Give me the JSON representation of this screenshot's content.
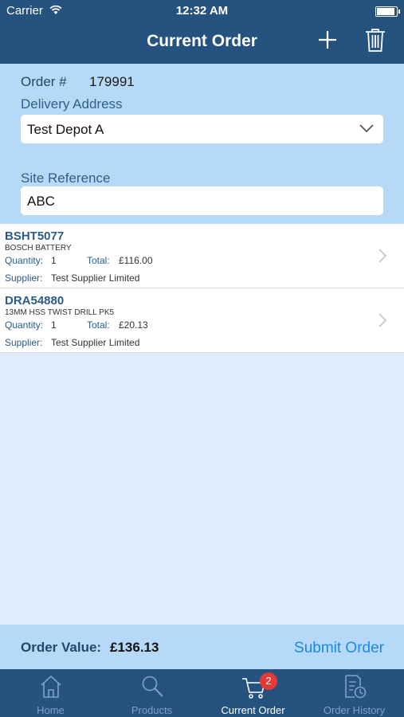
{
  "status_bar": {
    "carrier": "Carrier",
    "time": "12:32 AM"
  },
  "nav": {
    "title": "Current Order",
    "add_icon": "plus-icon",
    "delete_icon": "trash-icon"
  },
  "order": {
    "number_label": "Order #",
    "number": "179991",
    "address_label": "Delivery Address",
    "address_value": "Test Depot A",
    "site_label": "Site Reference",
    "site_value": "ABC"
  },
  "items": [
    {
      "code": "BSHT5077",
      "description": "BOSCH BATTERY",
      "quantity_label": "Quantity:",
      "quantity": "1",
      "total_label": "Total:",
      "total": "£116.00",
      "supplier_label": "Supplier:",
      "supplier": "Test Supplier Limited"
    },
    {
      "code": "DRA54880",
      "description": "13MM HSS TWIST DRILL PK5",
      "quantity_label": "Quantity:",
      "quantity": "1",
      "total_label": "Total:",
      "total": "£20.13",
      "supplier_label": "Supplier:",
      "supplier": "Test Supplier Limited"
    }
  ],
  "footer": {
    "order_value_label": "Order Value:",
    "order_value": "£136.13",
    "submit_label": "Submit Order"
  },
  "tabs": [
    {
      "label": "Home",
      "icon": "home-icon",
      "active": false
    },
    {
      "label": "Products",
      "icon": "search-icon",
      "active": false
    },
    {
      "label": "Current Order",
      "icon": "cart-icon",
      "active": true,
      "badge": "2"
    },
    {
      "label": "Order History",
      "icon": "history-icon",
      "active": false
    }
  ],
  "colors": {
    "nav_bar": "#26527f",
    "form_bg": "#b7d9f8",
    "list_bg": "#dfeefc",
    "accent": "#1e88e5",
    "badge": "#e53935"
  }
}
